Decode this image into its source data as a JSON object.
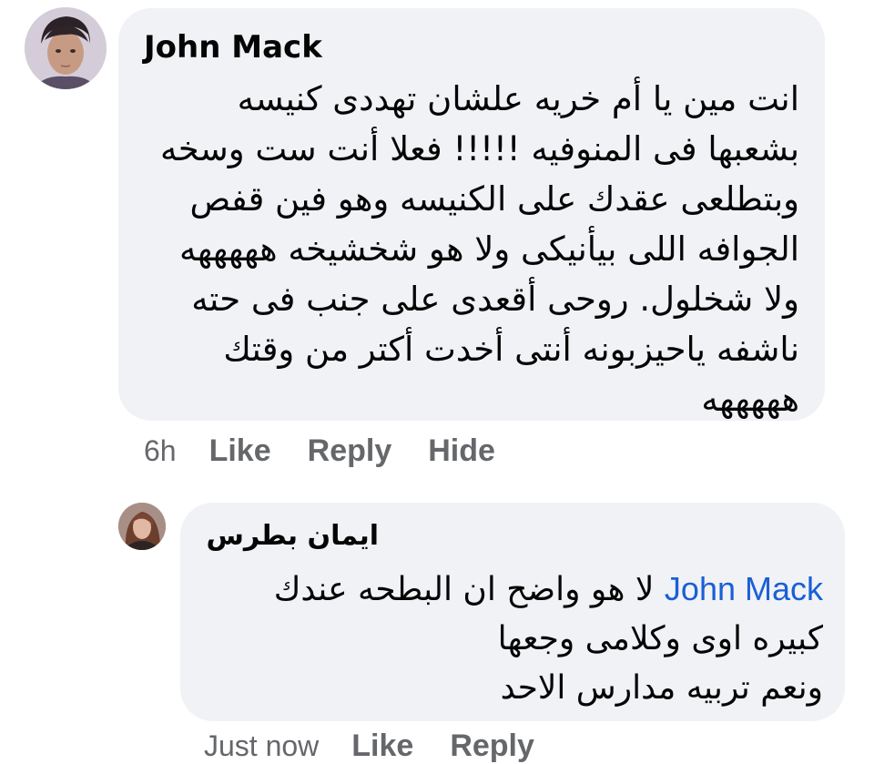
{
  "comments": [
    {
      "author": "John Mack",
      "text": "انت مين يا أم خريه علشان تهددى كنيسه\nبشعبها فى المنوفيه !!!!! فعلا أنت ست وسخه\nوبتطلعى عقدك على الكنيسه وهو فين قفص\nالجوافه اللى بيأنيكى ولا هو شخشيخه هههههه\nولا شخلول. روحى أقعدى على جنب فى حته\nناشفه ياحيزبونه أنتى أخدت أكتر من وقتك\nهههههه",
      "time": "6h",
      "actions": [
        "Like",
        "Reply",
        "Hide"
      ]
    },
    {
      "author": "ايمان بطرس",
      "mention": "John Mack",
      "text_line1": " لا هو واضح ان البطحه عندك",
      "text_rest": "كبيره اوى وكلامى وجعها\nونعم تربيه مدارس الاحد",
      "time": "Just now",
      "actions": [
        "Like",
        "Reply"
      ]
    }
  ],
  "colors": {
    "bubble": "#f0f2f5",
    "text": "#050505",
    "meta": "#65676b",
    "mention": "#1a5fd6"
  },
  "icons": [
    "avatar-john-mack",
    "avatar-eman-botros"
  ]
}
